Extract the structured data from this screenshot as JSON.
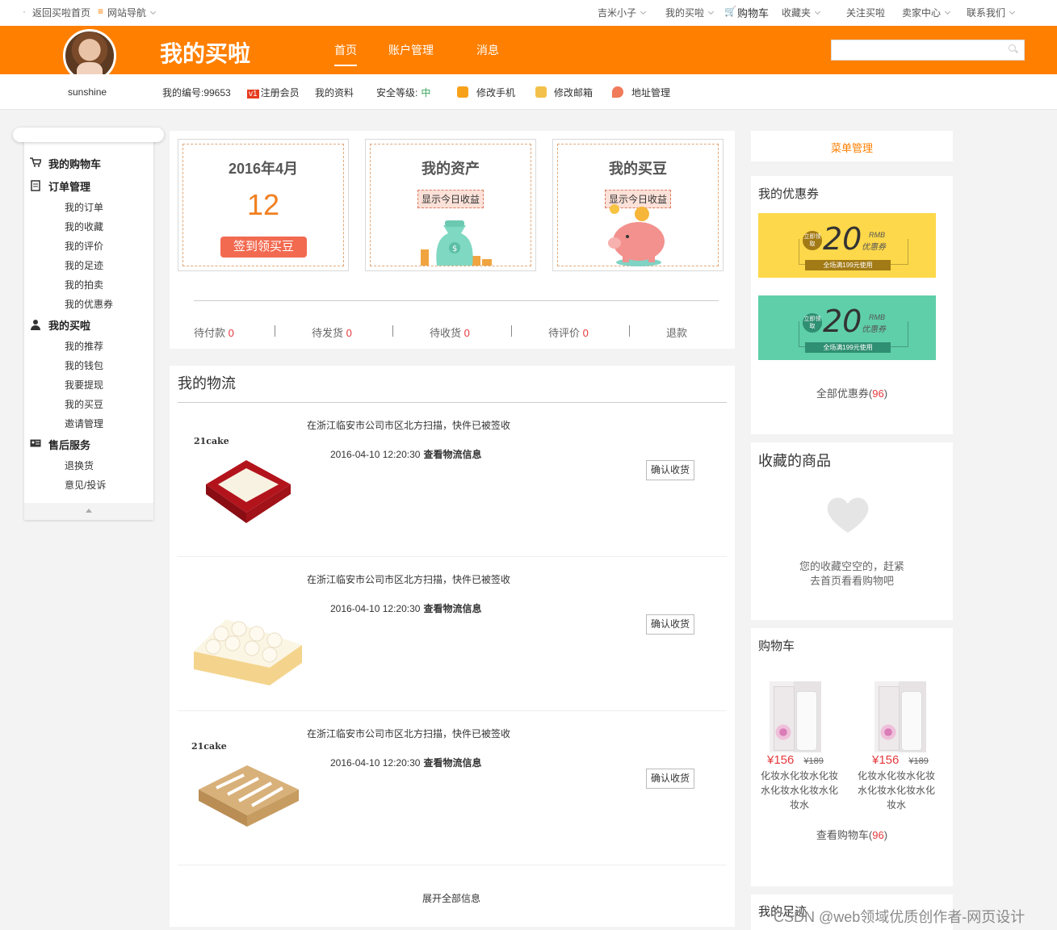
{
  "topbar": {
    "back_home": "返回买啦首页",
    "site_nav": "网站导航",
    "user": "吉米小子",
    "my_maila": "我的买啦",
    "cart": "购物车",
    "favorites": "收藏夹",
    "follow": "关注买啦",
    "seller": "卖家中心",
    "contact": "联系我们"
  },
  "header": {
    "brand": "我的买啦",
    "nav": [
      "首页",
      "账户管理",
      "消息"
    ],
    "username": "sunshine"
  },
  "infobar": {
    "id": "我的编号:99653",
    "vip_badge": "v1",
    "register": "注册会员",
    "profile": "我的资料",
    "security_label": "安全等级:",
    "security_level": "中",
    "edit_phone": "修改手机",
    "edit_email": "修改邮箱",
    "address": "地址管理"
  },
  "sidebar": {
    "groups": [
      {
        "label": "我的购物车",
        "items": []
      },
      {
        "label": "订单管理",
        "items": [
          "我的订单",
          "我的收藏",
          "我的评价",
          "我的足迹",
          "我的拍卖",
          "我的优惠券"
        ]
      },
      {
        "label": "我的买啦",
        "items": [
          "我的推荐",
          "我的钱包",
          "我要提现",
          "我的买豆",
          "邀请管理"
        ]
      },
      {
        "label": "售后服务",
        "items": [
          "退换货",
          "意见/投诉"
        ]
      }
    ]
  },
  "cards": {
    "signin": {
      "title": "2016年4月",
      "day": "12",
      "button": "签到领买豆"
    },
    "assets": {
      "title": "我的资产",
      "pill": "显示今日收益"
    },
    "beans": {
      "title": "我的买豆",
      "pill": "显示今日收益"
    }
  },
  "order_status": [
    {
      "label": "待付款",
      "count": "0"
    },
    {
      "label": "待发货",
      "count": "0"
    },
    {
      "label": "待收货",
      "count": "0"
    },
    {
      "label": "待评价",
      "count": "0"
    },
    {
      "label": "退款",
      "count": ""
    }
  ],
  "logistics": {
    "title": "我的物流",
    "items": [
      {
        "text": "在浙江临安市公司市区北方扫描，快件已被签收",
        "time": "2016-04-10 12:20:30",
        "link": "查看物流信息",
        "button": "确认收货",
        "logo": "21cake"
      },
      {
        "text": "在浙江临安市公司市区北方扫描，快件已被签收",
        "time": "2016-04-10 12:20:30",
        "link": "查看物流信息",
        "button": "确认收货",
        "logo": ""
      },
      {
        "text": "在浙江临安市公司市区北方扫描，快件已被签收",
        "time": "2016-04-10 12:20:30",
        "link": "查看物流信息",
        "button": "确认收货",
        "logo": "21cake"
      }
    ],
    "expand": "展开全部信息"
  },
  "right": {
    "menu": "菜单管理",
    "coupons_title": "我的优惠券",
    "coupons": [
      {
        "color": "#fdd84a",
        "bar_color": "#a27a16",
        "lead": "立即领取",
        "amount": "20",
        "unit": "RMB",
        "name": "优惠券",
        "condition": "全场满199元使用"
      },
      {
        "color": "#5fcfa9",
        "bar_color": "#2f8f72",
        "lead": "立即领取",
        "amount": "20",
        "unit": "RMB",
        "name": "优惠券",
        "condition": "全场满199元使用"
      }
    ],
    "all_coupons": "全部优惠券",
    "all_coupons_count": "96",
    "fav_title": "收藏的商品",
    "fav_empty_1": "您的收藏空空的，赶紧",
    "fav_empty_2": "去首页看看购物吧",
    "cart_title": "购物车",
    "cart_items": [
      {
        "price": "¥156",
        "old": "¥189",
        "name": "化妆水化妆水化妆水化妆水化妆水化妆水"
      },
      {
        "price": "¥156",
        "old": "¥189",
        "name": "化妆水化妆水化妆水化妆水化妆水化妆水"
      }
    ],
    "view_cart": "查看购物车",
    "view_cart_count": "96",
    "footprint_title": "我的足迹"
  },
  "watermark": "CSDN @web领域优质创作者-网页设计",
  "colors": {
    "brand": "#ff7f00",
    "accent": "#e4393c",
    "signin_button": "#f26a50"
  }
}
